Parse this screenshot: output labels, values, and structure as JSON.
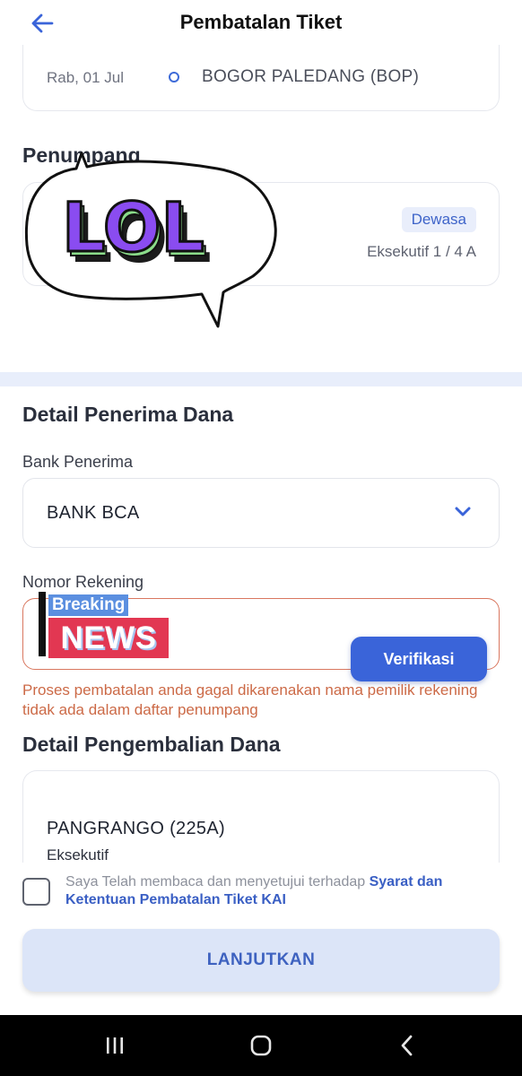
{
  "header": {
    "title": "Pembatalan Tiket",
    "back_icon": "arrow-left-icon"
  },
  "trip": {
    "date": "Rab, 01 Jul",
    "station": "BOGOR PALEDANG (BOP)"
  },
  "passenger_section": {
    "title": "Penumpang",
    "badge": "Dewasa",
    "seat": "Eksekutif 1 / 4 A"
  },
  "sticker_lol": {
    "text": "LOL"
  },
  "sticker_news": {
    "top": "Breaking",
    "main": "NEWS"
  },
  "recipient": {
    "title": "Detail Penerima Dana",
    "bank_label": "Bank Penerima",
    "bank_value": "BANK BCA",
    "account_label": "Nomor Rekening",
    "account_value": "",
    "verify_button": "Verifikasi",
    "error": "Proses pembatalan anda gagal dikarenakan nama pemilik rekening tidak ada dalam daftar penumpang"
  },
  "refund": {
    "title": "Detail Pengembalian Dana",
    "train_name": "PANGRANGO (225A)",
    "train_class": "Eksekutif"
  },
  "agreement": {
    "text": "Saya Telah membaca dan menyetujui terhadap ",
    "link": "Syarat dan Ketentuan Pembatalan Tiket KAI",
    "checked": false
  },
  "continue_button": "LANJUTKAN",
  "colors": {
    "accent": "#3a64d9",
    "error": "#cc6a47",
    "band": "#e8eefb",
    "disabled_button": "#dce5f8"
  },
  "navbar": {
    "recent_icon": "recent-apps-icon",
    "home_icon": "home-icon",
    "back_icon": "back-chevron-icon"
  }
}
